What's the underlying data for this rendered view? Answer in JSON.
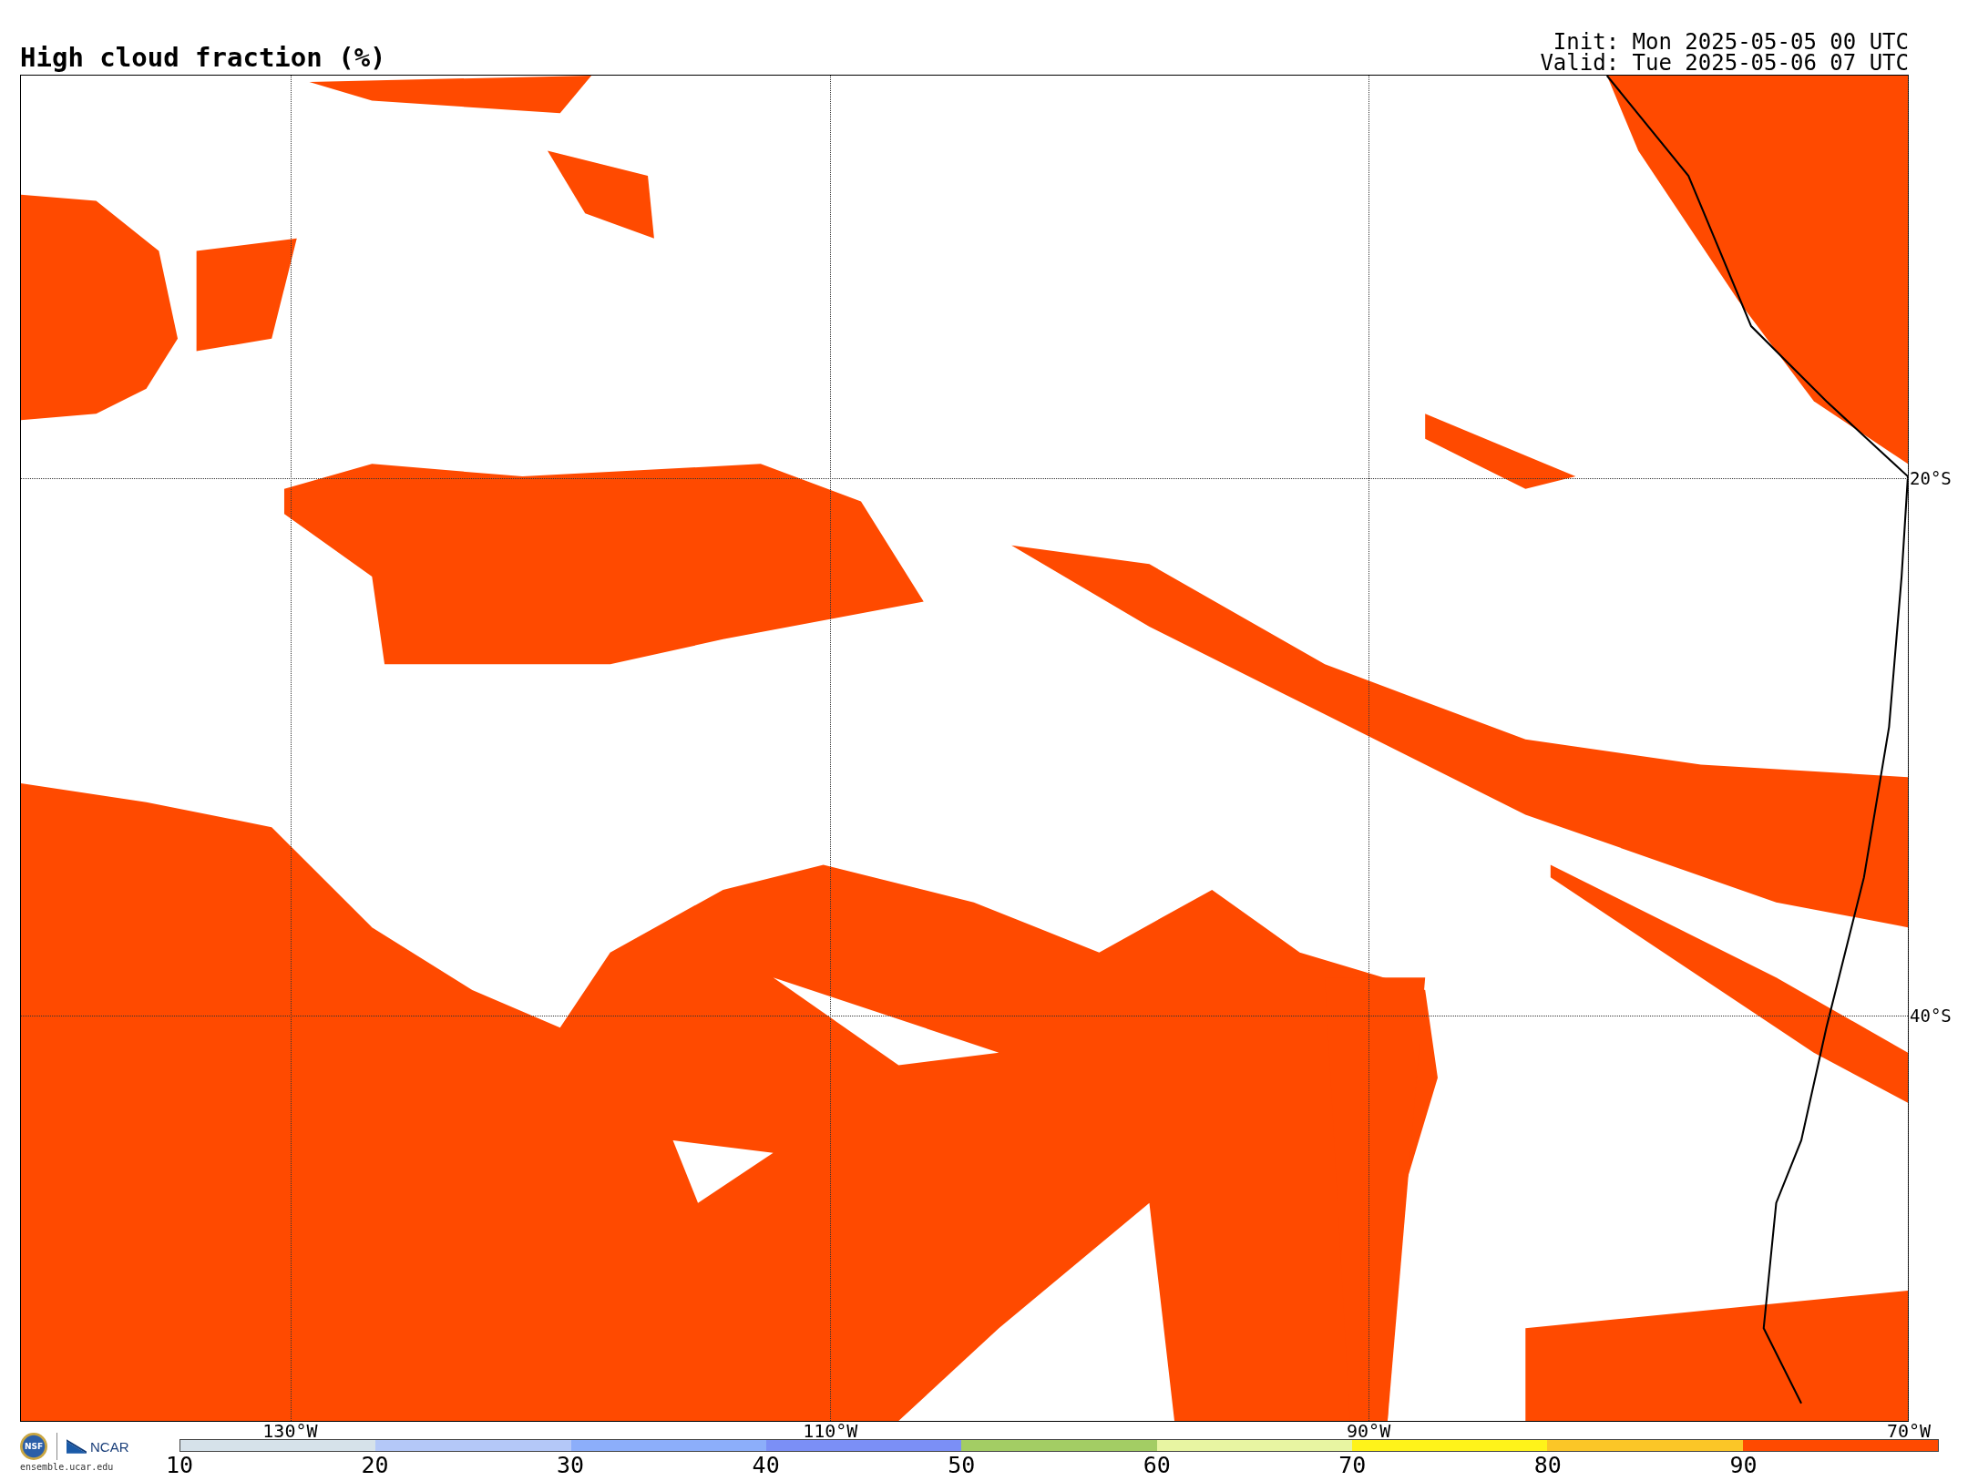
{
  "title": "High cloud fraction (%)",
  "init": "Init: Mon 2025-05-05 00 UTC",
  "valid": "Valid: Tue 2025-05-06 07 UTC",
  "map": {
    "lon_labels": [
      "130°W",
      "110°W",
      "90°W",
      "70°W"
    ],
    "lat_labels": [
      "20°S",
      "40°S"
    ]
  },
  "logo": {
    "seal": "NSF",
    "org": "NCAR",
    "site": "ensemble.ucar.edu"
  },
  "colorbar": {
    "bins": [
      {
        "color": "#d6e2ea"
      },
      {
        "color": "#b4c8f8"
      },
      {
        "color": "#8caefa"
      },
      {
        "color": "#7b8ff6"
      },
      {
        "color": "#a3cd64"
      },
      {
        "color": "#e8f5a2"
      },
      {
        "color": "#fff31a"
      },
      {
        "color": "#fbc627"
      },
      {
        "color": "#ff4a00"
      }
    ],
    "ticks": [
      "10",
      "20",
      "30",
      "40",
      "50",
      "60",
      "70",
      "80",
      "90"
    ]
  }
}
